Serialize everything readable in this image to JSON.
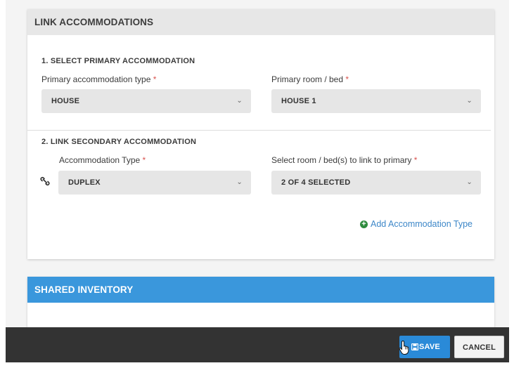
{
  "link_card": {
    "title": "LINK ACCOMMODATIONS",
    "primary": {
      "section_title": "1. SELECT PRIMARY ACCOMMODATION",
      "type_label": "Primary accommodation type",
      "type_value": "HOUSE",
      "room_label": "Primary room / bed",
      "room_value": "HOUSE 1"
    },
    "secondary": {
      "section_title": "2. LINK SECONDARY ACCOMMODATION",
      "type_label": "Accommodation Type",
      "type_value": "DUPLEX",
      "room_label": "Select room / bed(s) to link to primary",
      "room_value": "2 OF 4 SELECTED"
    },
    "add_link_label": "Add Accommodation Type",
    "required_mark": "*"
  },
  "inventory_card": {
    "title": "SHARED INVENTORY"
  },
  "footer": {
    "save_label": "SAVE",
    "cancel_label": "CANCEL"
  },
  "colors": {
    "accent": "#3a97dc",
    "save_button": "#2a8ad8",
    "required": "#d9534f",
    "add_icon": "#2e8b3d",
    "footer_bg": "#333333"
  },
  "icons": [
    "chevron-down-icon",
    "link-icon",
    "plus-circle-icon",
    "floppy-disk-icon",
    "hand-pointer-icon"
  ]
}
